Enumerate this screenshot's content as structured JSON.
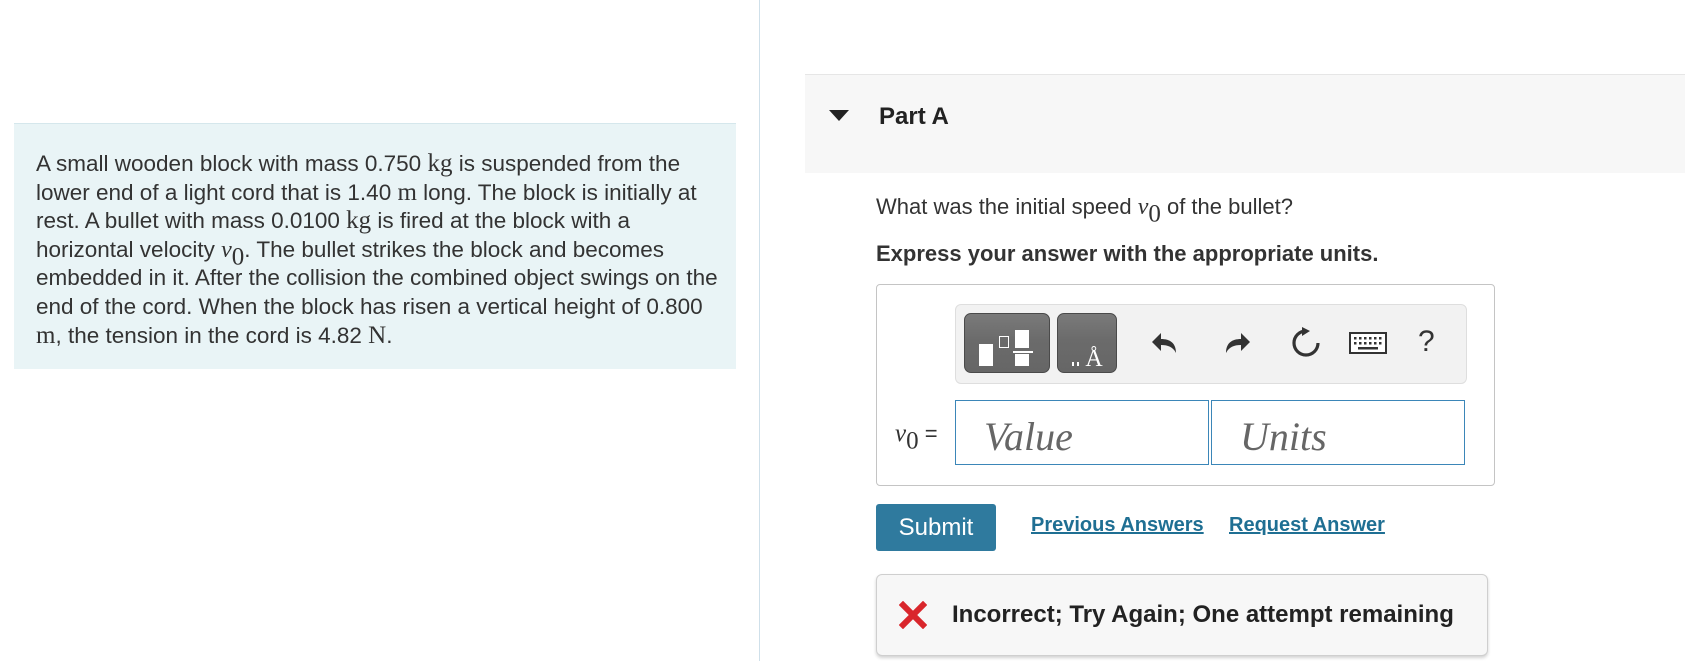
{
  "problem": {
    "segments": {
      "s1": "A small wooden block with mass 0.750 ",
      "m1": "kg",
      "s2": " is suspended from the lower end of a light cord that is 1.40 ",
      "m2": "m",
      "s3": " long. The block is initially at rest. A bullet with mass 0.0100 ",
      "m3": "kg",
      "s4": " is fired at the block with a horizontal velocity ",
      "v_sym": "v",
      "v_sub": "0",
      "s5": ". The bullet strikes the block and becomes embedded in it. After the collision the combined object swings on the end of the cord. When the block has risen a vertical height of 0.800 ",
      "m4": "m",
      "s6": ", the tension in the cord is 4.82 ",
      "m5": "N",
      "s7": "."
    }
  },
  "part": {
    "title": "Part A",
    "caret_icon": "caret-down-icon"
  },
  "question": {
    "before": "What was the initial speed ",
    "v_sym": "v",
    "v_sub": "0",
    "after": " of the bullet?"
  },
  "instruction": "Express your answer with the appropriate units.",
  "answer": {
    "label_sym": "v",
    "label_sub": "0",
    "label_eq": " =",
    "value_placeholder": "Value",
    "units_placeholder": "Units",
    "toolbar": {
      "buttons": [
        "templates-icon",
        "units-icon",
        "undo-icon",
        "redo-icon",
        "reset-icon",
        "keyboard-icon",
        "help-icon"
      ],
      "help_label": "?"
    }
  },
  "actions": {
    "submit_label": "Submit",
    "previous_answers_label": "Previous Answers",
    "request_answer_label": "Request Answer"
  },
  "feedback": {
    "text": "Incorrect; Try Again; One attempt remaining",
    "status_color": "#d9262c"
  },
  "colors": {
    "accent": "#2f7a9e",
    "link": "#1f6f93",
    "problem_bg": "#e9f4f6"
  }
}
